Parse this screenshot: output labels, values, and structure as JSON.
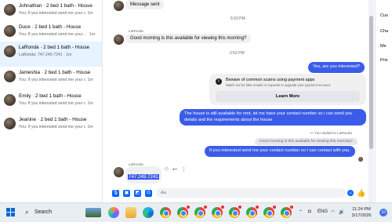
{
  "conversations": [
    {
      "name": "Johnathan · 2 bed 1 bath - House",
      "preview": "You: If you interested send me your c",
      "time": "1m"
    },
    {
      "name": "Duce · 2 bed 1 bath - House",
      "preview": "You: If you interested send me your co",
      "time": "1m"
    },
    {
      "name": "LaRonda · 2 bed 1 bath - House",
      "preview": "LaRonda: 747.249.7241 · 1m",
      "time": ""
    },
    {
      "name": "Jameshia · 2 bed 1 bath - House",
      "preview": "You: If you interested send me your c",
      "time": "1m"
    },
    {
      "name": "Emily · 2 bed 1 bath - House",
      "preview": "You: If you interested send me your c",
      "time": "1m"
    },
    {
      "name": "Jeanine · 2 bed 1 bath - House",
      "preview": "You: If you interested send me your c",
      "time": "1m"
    }
  ],
  "chat": {
    "message_sent": "Message sent",
    "time1": "5:03 PM",
    "sender1": "LaRonda",
    "msg_in1": "Good morning is this available for viewing this morning?",
    "time2": "2:52 PM",
    "msg_out1": "Yes, are you interested?",
    "warning_title": "Beware of common scams using payment apps",
    "warning_sub": "Watch out for fake emails or requests to upgrade your payment account.",
    "learn_more": "Learn More",
    "msg_out2": "The house is still available for rent, let me have your contact number so i can send you details and the requirements about the house",
    "replied_note": "You replied to LaRonda",
    "quoted": "Good morning is this available for viewing this morning?",
    "msg_out3": "If you interested send me your contact number so I can contact with you.",
    "sender2": "LaRonda",
    "phone": "747.249.7241",
    "input_placeholder": "Aa"
  },
  "right_panel": [
    "Cus",
    "Cha",
    "Me",
    "Priv"
  ],
  "taskbar": {
    "search_label": "Search",
    "lang": "ENG",
    "time": "11:24 PM",
    "date": "3/17/2026",
    "notifications": "10"
  },
  "colors": {
    "accent": "#3b5ce8",
    "active_row": "#e7f3ff",
    "taskbar": "#e9eef3"
  }
}
